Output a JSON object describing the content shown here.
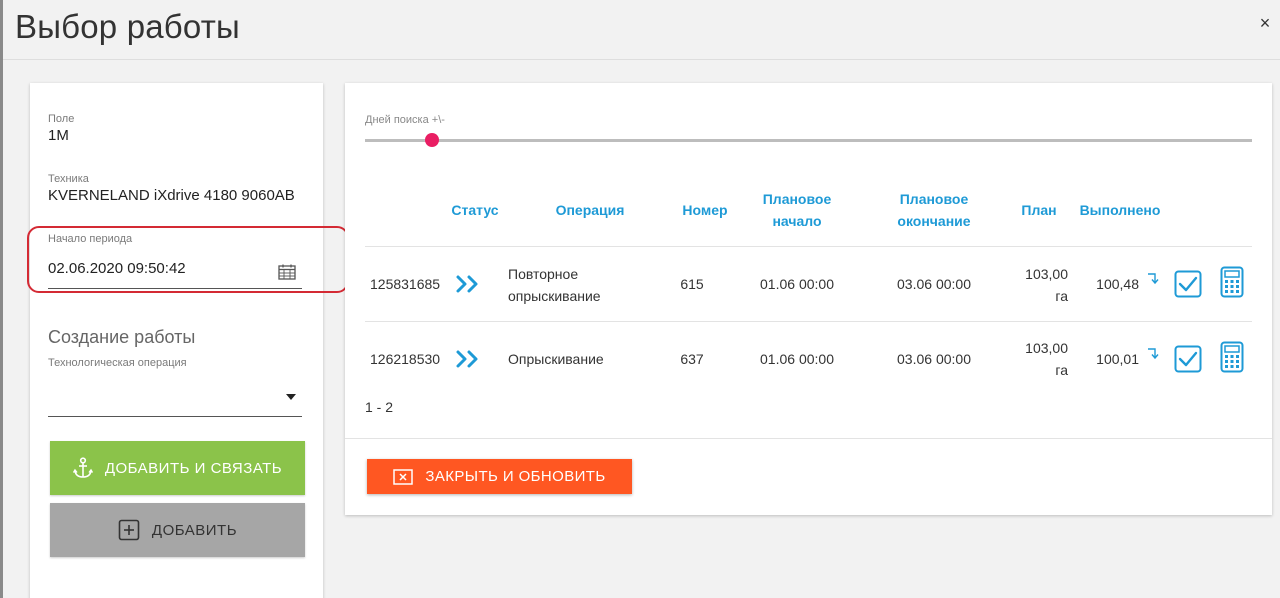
{
  "dialog": {
    "title": "Выбор работы",
    "close_symbol": "×"
  },
  "left_panel": {
    "field": {
      "label": "Поле",
      "value": "1M"
    },
    "machinery": {
      "label": "Техника",
      "value": "KVERNELAND iXdrive 4180 9060AB"
    },
    "period_start": {
      "label": "Начало периода",
      "value": "02.06.2020 09:50:42",
      "icon": "calendar-icon"
    },
    "create_work": {
      "title": "Создание работы",
      "operation_label": "Технологическая операция",
      "operation_value": ""
    },
    "buttons": {
      "add_and_link": {
        "label": "ДОБАВИТЬ И СВЯЗАТЬ",
        "icon": "anchor-icon",
        "color": "#8bc34a"
      },
      "add": {
        "label": "ДОБАВИТЬ",
        "icon": "plus-square-icon",
        "color": "#a6a6a6"
      }
    }
  },
  "right_panel": {
    "search_days": {
      "label": "Дней поиска +\\-",
      "level_fraction": 0.075
    },
    "columns": {
      "status": "Статус",
      "operation": "Операция",
      "number": "Номер",
      "planned_start_1": "Плановое",
      "planned_start_2": "начало",
      "planned_end_1": "Плановое",
      "planned_end_2": "окончание",
      "plan": "План",
      "done": "Выполнено"
    },
    "rows": [
      {
        "id": "125831685",
        "status_icon": "double-chevron-right-icon",
        "operation_1": "Повторное",
        "operation_2": "опрыскивание",
        "number": "615",
        "planned_start": "01.06 00:00",
        "planned_end": "03.06 00:00",
        "plan_1": "103,00",
        "plan_2": "га",
        "done": "100,48"
      },
      {
        "id": "126218530",
        "status_icon": "double-chevron-right-icon",
        "operation_1": "Опрыскивание",
        "operation_2": "",
        "number": "637",
        "planned_start": "01.06 00:00",
        "planned_end": "03.06 00:00",
        "plan_1": "103,00",
        "plan_2": "га",
        "done": "100,01"
      }
    ],
    "pager": "1 - 2",
    "close_refresh": {
      "label": "ЗАКРЫТЬ И ОБНОВИТЬ",
      "icon": "close-box-icon",
      "color": "#ff5722"
    }
  },
  "colors": {
    "accent_blue": "#1e9ad6",
    "slider_thumb": "#e91e63",
    "highlight_red": "#d42a34"
  }
}
